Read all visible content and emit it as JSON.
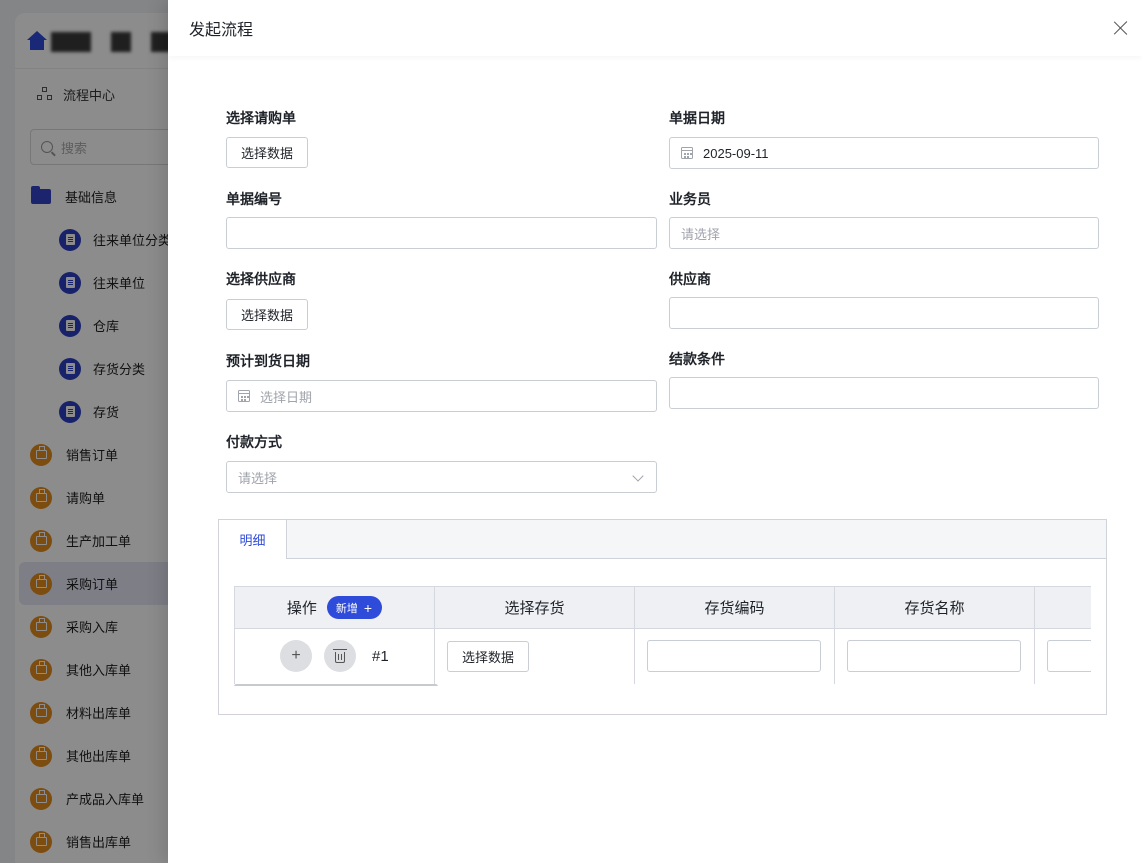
{
  "background": {
    "flow_center_label": "流程中心",
    "search_placeholder": "搜索",
    "group_label": "基础信息",
    "group_items": [
      "往来单位分类",
      "往来单位",
      "仓库",
      "存货分类",
      "存货"
    ],
    "nav_items": [
      "销售订单",
      "请购单",
      "生产加工单",
      "采购订单",
      "采购入库",
      "其他入库单",
      "材料出库单",
      "其他出库单",
      "产成品入库单",
      "销售出库单"
    ],
    "active_nav": "采购订单"
  },
  "drawer": {
    "title": "发起流程",
    "close_icon": "close-icon"
  },
  "form": {
    "purchase_request": {
      "label": "选择请购单",
      "button": "选择数据"
    },
    "doc_date": {
      "label": "单据日期",
      "value": "2025-09-11"
    },
    "doc_number": {
      "label": "单据编号",
      "value": ""
    },
    "salesperson": {
      "label": "业务员",
      "placeholder": "请选择"
    },
    "select_supplier": {
      "label": "选择供应商",
      "button": "选择数据"
    },
    "supplier": {
      "label": "供应商",
      "value": ""
    },
    "expected_date": {
      "label": "预计到货日期",
      "placeholder": "选择日期"
    },
    "settlement_terms": {
      "label": "结款条件",
      "value": ""
    },
    "payment_method": {
      "label": "付款方式",
      "placeholder": "请选择"
    }
  },
  "detail": {
    "tab_label": "明细",
    "columns": [
      "操作",
      "选择存货",
      "存货编码",
      "存货名称"
    ],
    "add_button": "新增",
    "add_icon": "+",
    "rows": [
      {
        "index": "#1",
        "select_button": "选择数据",
        "code": "",
        "name": ""
      }
    ]
  },
  "colors": {
    "accent": "#2e4bd9",
    "badge_orange": "#e38a1c",
    "overlay": "rgba(0,0,0,0.45)"
  }
}
